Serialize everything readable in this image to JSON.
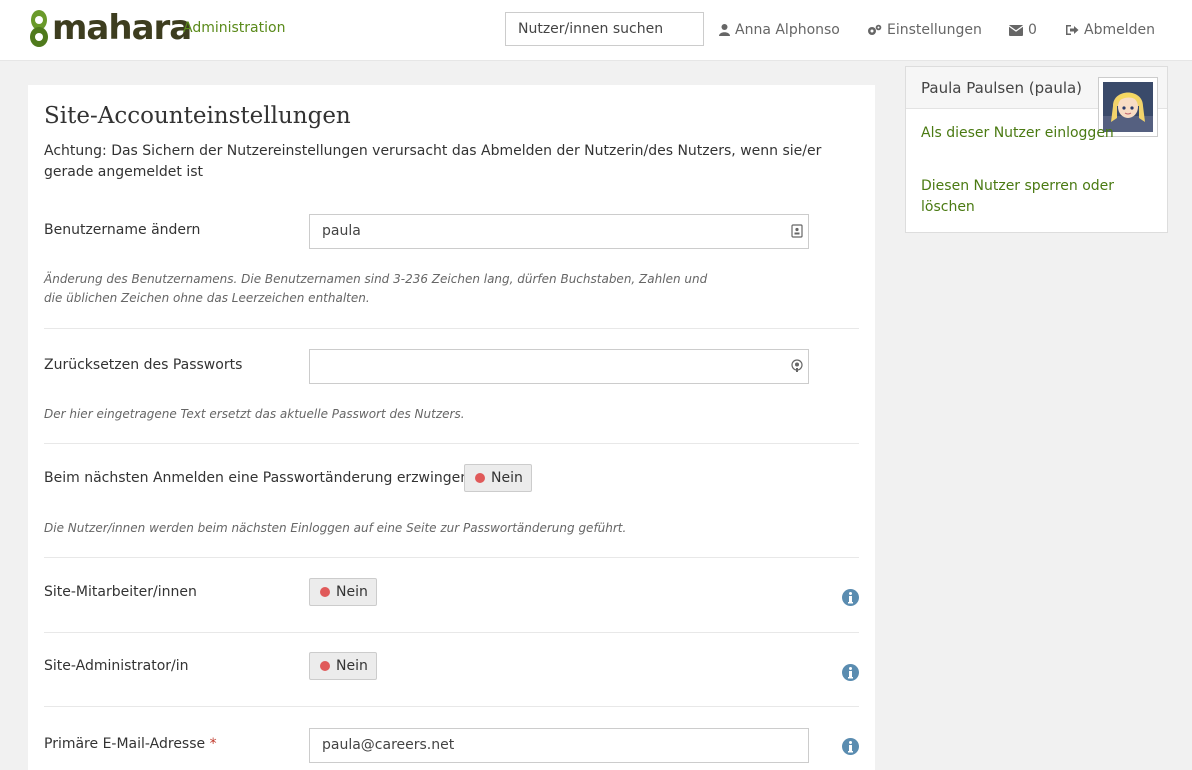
{
  "header": {
    "logo_text": "mahara",
    "admin_label": "Administration",
    "search_placeholder": "Nutzer/innen suchen",
    "user_name": "Anna Alphonso",
    "settings_label": "Einstellungen",
    "inbox_count": "0",
    "logout_label": "Abmelden"
  },
  "page": {
    "title": "Site-Accounteinstellungen",
    "warning": "Achtung: Das Sichern der Nutzereinstellungen verursacht das Abmelden der Nutzerin/des Nutzers, wenn sie/er gerade angemeldet ist"
  },
  "form": {
    "username": {
      "label": "Benutzername ändern",
      "value": "paula",
      "description": "Änderung des Benutzernamens. Die Benutzernamen sind 3-236 Zeichen lang, dürfen Buchstaben, Zahlen und die üblichen Zeichen ohne das Leerzeichen enthalten."
    },
    "password": {
      "label": "Zurücksetzen des Passworts",
      "value": "",
      "description": "Der hier eingetragene Text ersetzt das aktuelle Passwort des Nutzers."
    },
    "force_change": {
      "label": "Beim nächsten Anmelden eine Passwortänderung erzwingen",
      "state": "Nein",
      "description": "Die Nutzer/innen werden beim nächsten Einloggen auf eine Seite zur Passwortänderung geführt."
    },
    "staff": {
      "label": "Site-Mitarbeiter/innen",
      "state": "Nein"
    },
    "admin": {
      "label": "Site-Administrator/in",
      "state": "Nein"
    },
    "email": {
      "label": "Primäre E-Mail-Adresse",
      "required_mark": "*",
      "value": "paula@careers.net"
    }
  },
  "sidebar": {
    "user_title": "Paula Paulsen (paula)",
    "login_as": "Als dieser Nutzer einloggen",
    "suspend_delete": "Diesen Nutzer sperren oder löschen"
  },
  "colors": {
    "link_green": "#4a7a12",
    "switch_off_dot": "#e05a5a",
    "info_blue": "#5a8cb0"
  }
}
